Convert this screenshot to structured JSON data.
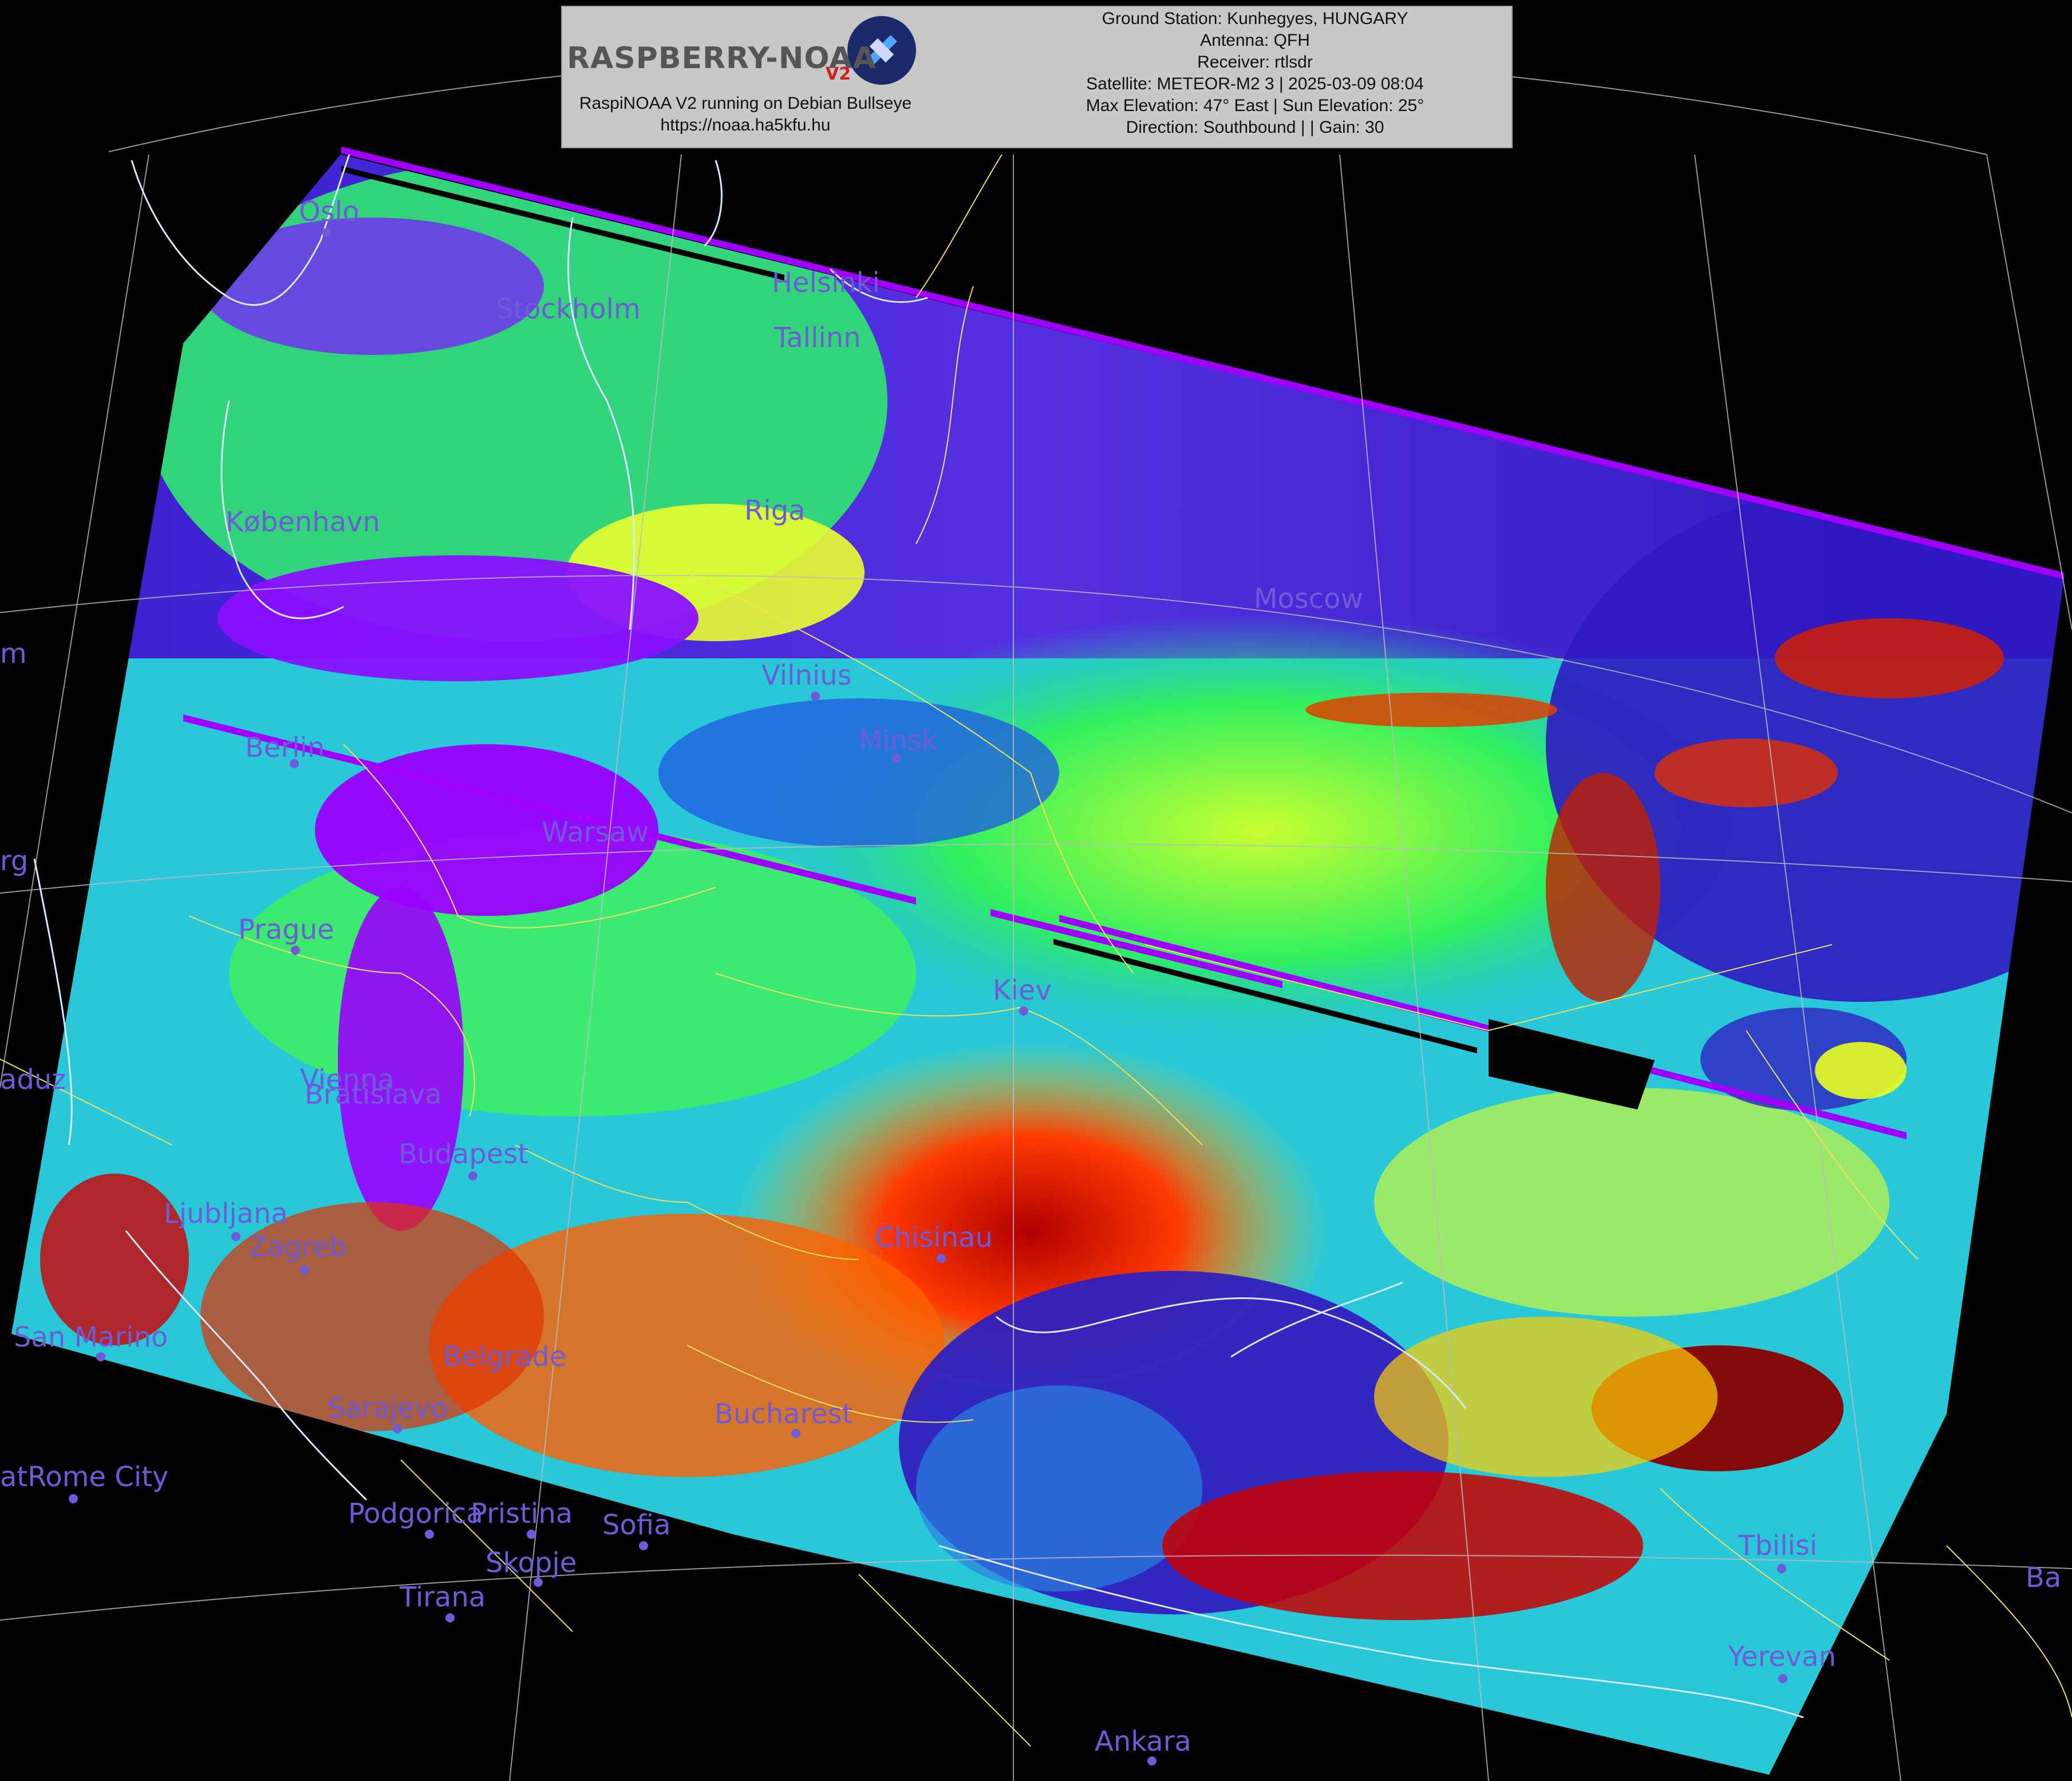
{
  "header": {
    "logo_text": "RASPBERRY-NOAA",
    "logo_suffix": "V2",
    "system_line": "RaspiNOAA V2 running on Debian Bullseye",
    "url": "https://noaa.ha5kfu.hu",
    "ground_station": "Ground Station: Kunhegyes, HUNGARY",
    "antenna": "Antenna: QFH",
    "receiver": "Receiver: rtlsdr",
    "satellite": "Satellite: METEOR-M2 3 | 2025-03-09 08:04",
    "elevation": "Max Elevation: 47° East | Sun Elevation: 25°",
    "direction": "Direction: Southbound | | Gain: 30"
  },
  "cities": {
    "oslo": "Oslo",
    "stockholm": "Stockholm",
    "helsinki": "Helsinki",
    "tallinn": "Tallinn",
    "riga": "Riga",
    "kobenhavn": "København",
    "moscow": "Moscow",
    "vilnius": "Vilnius",
    "minsk": "Minsk",
    "berlin": "Berlin",
    "warsaw": "Warsaw",
    "prague": "Prague",
    "kiev": "Kiev",
    "vienna": "Vienna",
    "bratislava": "Bratislava",
    "budapest": "Budapest",
    "ljubljana": "Ljubljana",
    "zagreb": "Zagreb",
    "chisinau": "Chisinau",
    "san_marino": "San Marino",
    "belgrade": "Belgrade",
    "sarajevo": "Sarajevo",
    "bucharest": "Bucharest",
    "vatican_rome": "atRome City",
    "podgorica": "Podgorica",
    "pristina": "Pristina",
    "sofia": "Sofia",
    "skopje": "Skopje",
    "tirana": "Tirana",
    "tbilisi": "Tbilisi",
    "yerevan": "Yerevan",
    "ankara": "Ankara",
    "amsterdam_partial": "m",
    "luxembourg_partial": "rg",
    "vaduz_partial": "aduz",
    "baku_partial": "Ba"
  },
  "colors": {
    "background": "#000000",
    "city_label": "#6f5bd8",
    "coastline": "#d8e8ff",
    "border": "#f0e060",
    "graticule": "#bdbdbd"
  }
}
